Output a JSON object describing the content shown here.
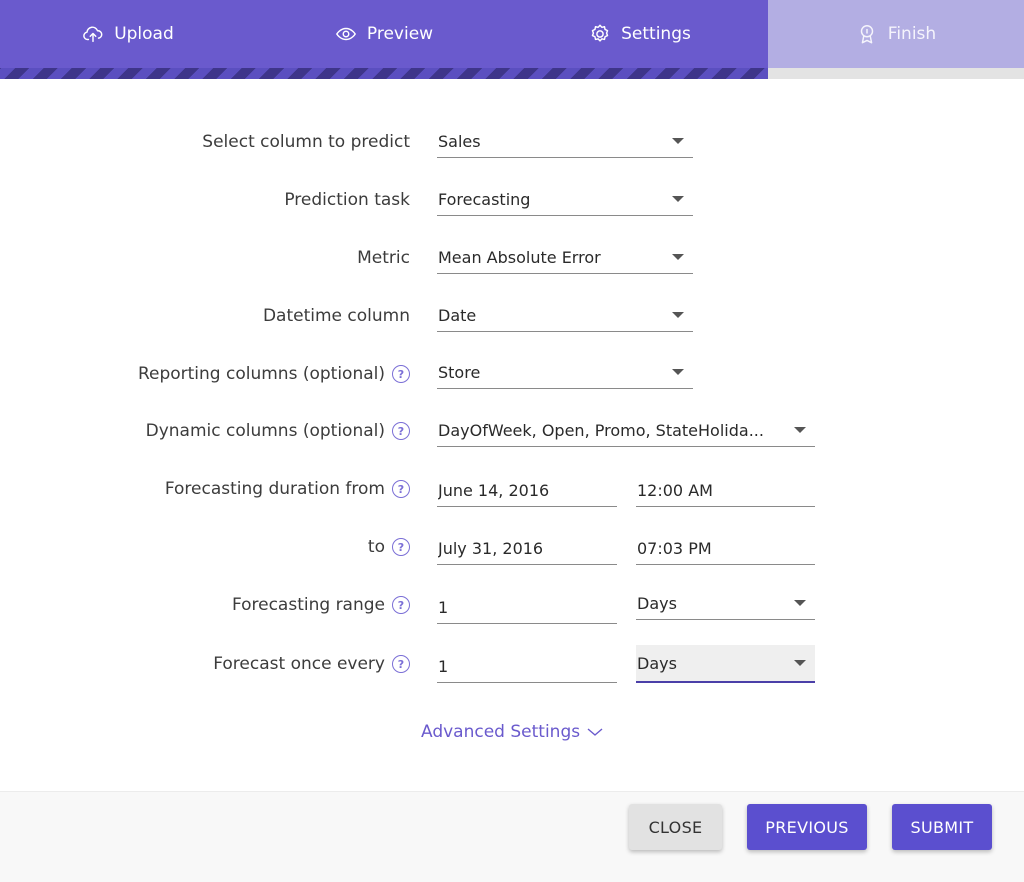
{
  "stepper": {
    "steps": [
      {
        "label": "Upload",
        "icon": "cloud-upload-icon",
        "state": "done"
      },
      {
        "label": "Preview",
        "icon": "eye-icon",
        "state": "done"
      },
      {
        "label": "Settings",
        "icon": "gear-icon",
        "state": "active"
      },
      {
        "label": "Finish",
        "icon": "award-icon",
        "state": "upcoming"
      }
    ],
    "progress": 0.75,
    "colors": {
      "active": "#6a5acd",
      "upcoming": "#b3aee3"
    }
  },
  "form": {
    "predict_column": {
      "label": "Select column to predict",
      "value": "Sales"
    },
    "prediction_task": {
      "label": "Prediction task",
      "value": "Forecasting"
    },
    "metric": {
      "label": "Metric",
      "value": "Mean Absolute Error"
    },
    "datetime_column": {
      "label": "Datetime column",
      "value": "Date"
    },
    "reporting_columns": {
      "label": "Reporting columns (optional)",
      "value": "Store"
    },
    "dynamic_columns": {
      "label": "Dynamic columns (optional)",
      "value": "DayOfWeek, Open, Promo, StateHolida..."
    },
    "duration_from": {
      "label": "Forecasting duration from",
      "date": "June 14, 2016",
      "time": "12:00 AM"
    },
    "duration_to": {
      "label": "to",
      "date": "July 31, 2016",
      "time": "07:03 PM"
    },
    "forecasting_range": {
      "label": "Forecasting range",
      "value": "1",
      "unit": "Days"
    },
    "forecast_every": {
      "label": "Forecast once every",
      "value": "1",
      "unit": "Days"
    },
    "help_glyph": "?",
    "advanced_label": "Advanced Settings"
  },
  "footer": {
    "close_label": "CLOSE",
    "previous_label": "PREVIOUS",
    "submit_label": "SUBMIT"
  },
  "accent_color": "#5b4fcf"
}
